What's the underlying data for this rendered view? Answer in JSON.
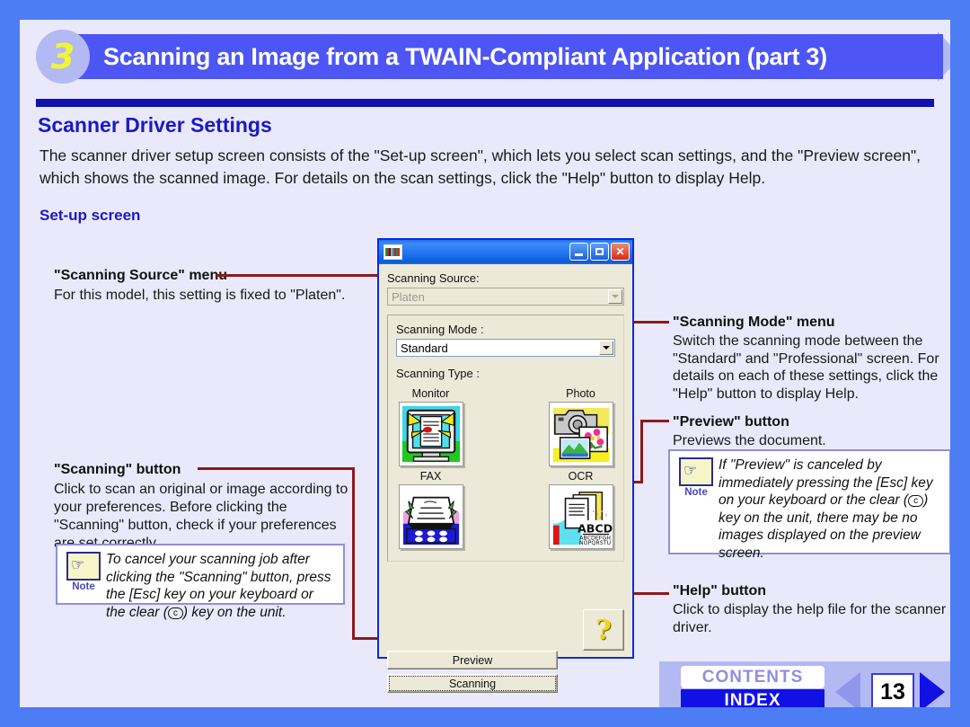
{
  "header": {
    "number": "3",
    "title": "Scanning an Image from a TWAIN-Compliant Application (part 3)"
  },
  "section_title": "Scanner Driver Settings",
  "intro": "The scanner driver setup screen consists of the \"Set-up screen\", which lets you select scan settings, and the \"Preview screen\", which shows the scanned image. For details on the scan settings, click the \"Help\" button to display Help.",
  "setup_label": "Set-up screen",
  "annotations": {
    "scanning_source": {
      "heading": "\"Scanning Source\" menu",
      "body": "For this model, this setting is fixed to \"Platen\"."
    },
    "scanning_button": {
      "heading": "\"Scanning\" button",
      "body": "Click to scan an original or image according to your preferences. Before clicking the \"Scanning\" button, check if your preferences are set correctly."
    },
    "scanning_mode": {
      "heading": "\"Scanning Mode\" menu",
      "body": "Switch the scanning mode between the \"Standard\" and \"Professional\" screen. For details on each of these settings, click the \"Help\" button to display Help."
    },
    "preview_button": {
      "heading": "\"Preview\" button",
      "body": "Previews the document."
    },
    "help_button": {
      "heading": "\"Help\" button",
      "body": "Click to display the help file for the scanner driver."
    }
  },
  "notes": [
    {
      "label": "Note",
      "text_a": "To cancel your scanning job after clicking the \"Scanning\" button, press the [Esc] key on your keyboard or the clear (",
      "key": "c",
      "text_b": ") key on the unit."
    },
    {
      "label": "Note",
      "text_a": "If \"Preview\" is canceled by immediately pressing the [Esc] key on your keyboard or the clear (",
      "key": "c",
      "text_b": ") key on the unit, there may be no images displayed on the preview screen."
    }
  ],
  "dialog": {
    "title": "",
    "window_buttons": [
      "minimize",
      "maximize",
      "close"
    ],
    "scanning_source_label": "Scanning Source:",
    "scanning_source_value": "Platen",
    "scanning_mode_label": "Scanning Mode :",
    "scanning_mode_value": "Standard",
    "scanning_type_label": "Scanning Type :",
    "types": [
      {
        "caption": "Monitor",
        "icon": "monitor-icon"
      },
      {
        "caption": "Photo",
        "icon": "photo-icon"
      },
      {
        "caption": "FAX",
        "icon": "fax-icon"
      },
      {
        "caption": "OCR",
        "icon": "ocr-icon"
      }
    ],
    "ocr_sample_big": "ABCD",
    "ocr_sample_line1": "ABCDEFGH",
    "ocr_sample_line2": "NOPQRSTU",
    "preview_button": "Preview",
    "scanning_button": "Scanning",
    "help_button": "?"
  },
  "footer": {
    "contents": "CONTENTS",
    "index": "INDEX",
    "page": "13",
    "prev": "previous-page",
    "next": "next-page"
  },
  "colors": {
    "page_border": "#4d7df5",
    "page_bg": "#e9e9fb",
    "header_bar": "#4d55f5",
    "header_circle": "#b3b9f2",
    "rule": "#1111b0",
    "heading_text": "#1a19c4",
    "connector": "#8c1b1b",
    "dialog_border": "#0a2bd6",
    "dialog_face": "#ece9d8",
    "index_bg": "#1111e6"
  }
}
